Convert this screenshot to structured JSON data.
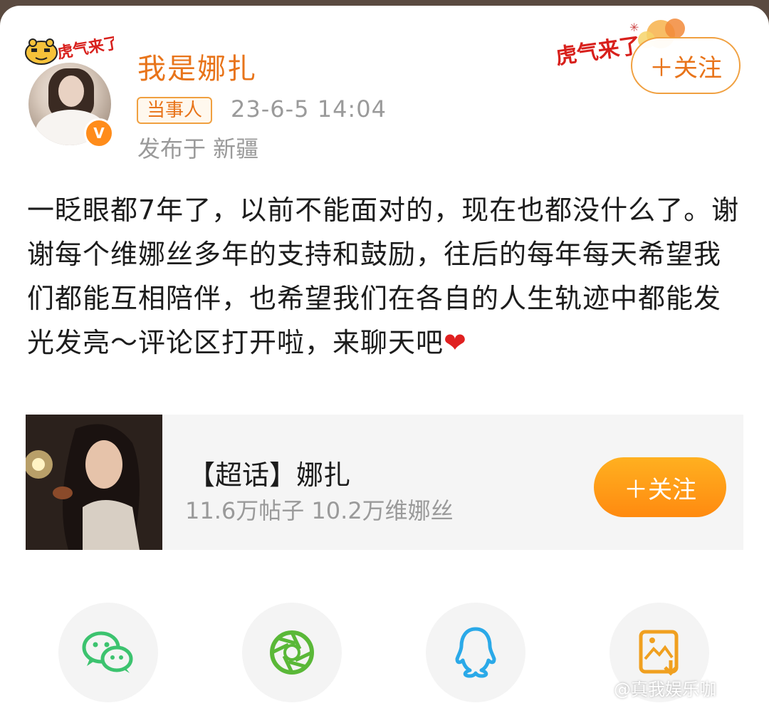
{
  "post": {
    "username": "我是娜扎",
    "role_badge": "当事人",
    "timestamp": "23-6-5 14:04",
    "location": "发布于 新疆",
    "follow_label": "＋关注",
    "pendant_text": "虎气来了",
    "text": "一眨眼都7年了，以前不能面对的，现在也都没什么了。谢谢每个维娜丝多年的支持和鼓励，往后的每年每天希望我们都能互相陪伴，也希望我们在各自的人生轨迹中都能发光发亮～评论区打开啦，来聊天吧",
    "heart": "❤"
  },
  "supertopic": {
    "title": "【超话】娜扎",
    "stats": "11.6万帖子 10.2万维娜丝",
    "follow_label": "＋关注"
  },
  "share": {
    "items": [
      {
        "icon": "wechat-icon"
      },
      {
        "icon": "moments-icon"
      },
      {
        "icon": "qq-icon"
      },
      {
        "icon": "save-image-icon"
      }
    ]
  },
  "watermark": "@真我娱乐咖",
  "colors": {
    "accent": "#e8741a",
    "follow_gradient": "#ff8a10",
    "wechat": "#3cc36f",
    "moments": "#5ab838",
    "qq": "#2aa9e8",
    "save": "#f0a020"
  }
}
